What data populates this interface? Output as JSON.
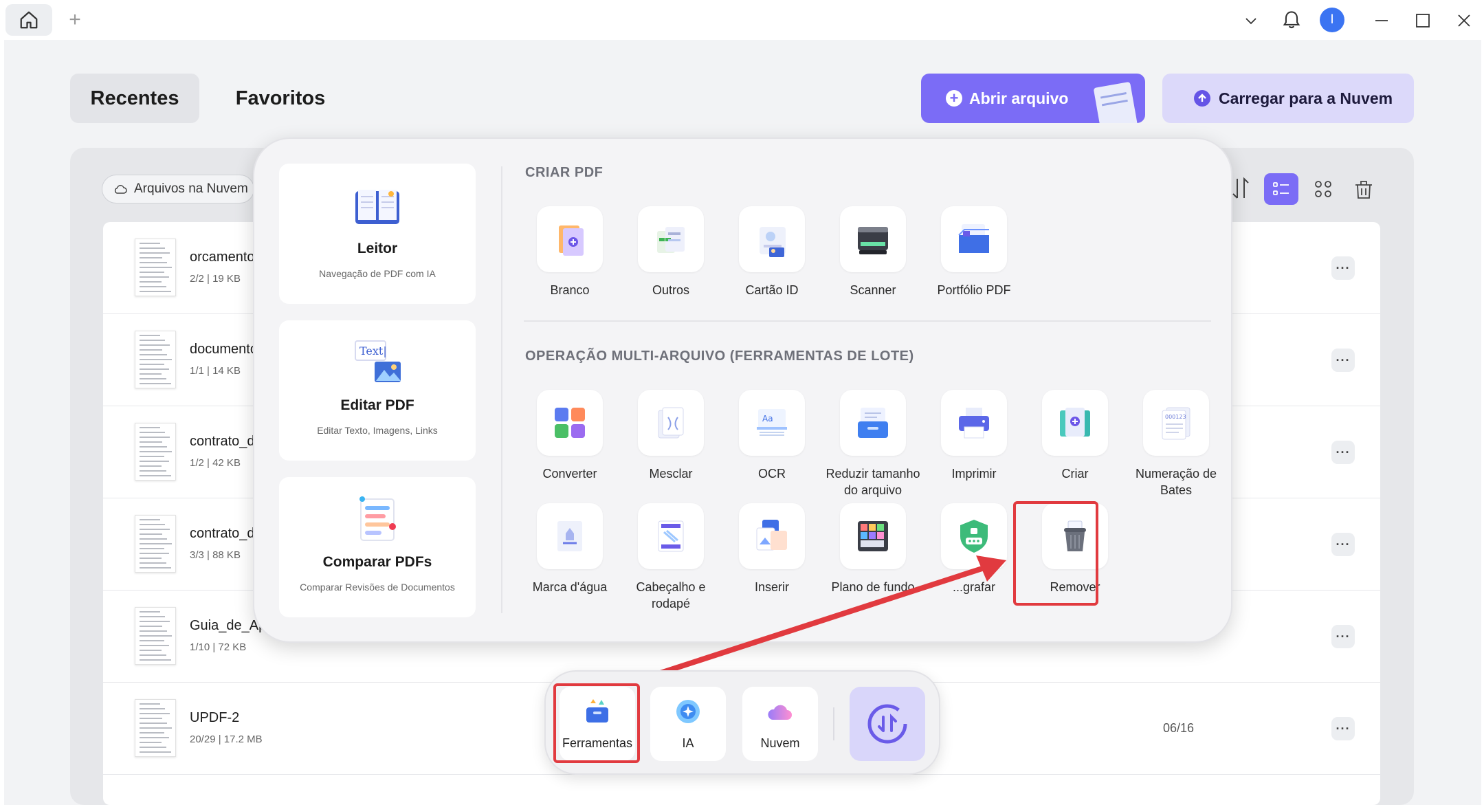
{
  "titlebar": {
    "home_tab": "home-icon",
    "new_tab": "+",
    "avatar_letter": "I"
  },
  "tabs": {
    "recent": "Recentes",
    "favorites": "Favoritos"
  },
  "buttons": {
    "open_file": "Abrir arquivo",
    "upload_cloud": "Carregar para a Nuvem",
    "cloud_files": "Arquivos na Nuvem"
  },
  "files": [
    {
      "name": "orcamento_",
      "meta": "2/2 | 19 KB",
      "date": ""
    },
    {
      "name": "documento",
      "meta": "1/1 | 14 KB",
      "date": ""
    },
    {
      "name": "contrato_de",
      "meta": "1/2 | 42 KB",
      "date": ""
    },
    {
      "name": "contrato_de",
      "meta": "3/3 | 88 KB",
      "date": ""
    },
    {
      "name": "Guia_de_Ap",
      "meta": "1/10 | 72 KB",
      "date": ""
    },
    {
      "name": "UPDF-2",
      "meta": "20/29 | 17.2 MB",
      "date": "06/16"
    }
  ],
  "popup": {
    "cards": [
      {
        "title": "Leitor",
        "subtitle": "Navegação de PDF com IA"
      },
      {
        "title": "Editar PDF",
        "subtitle": "Editar Texto, Imagens, Links"
      },
      {
        "title": "Comparar PDFs",
        "subtitle": "Comparar Revisões de Documentos"
      }
    ],
    "create_title": "CRIAR PDF",
    "create_items": [
      {
        "label": "Branco",
        "icon": "blank-page-icon"
      },
      {
        "label": "Outros",
        "icon": "other-files-icon"
      },
      {
        "label": "Cartão ID",
        "icon": "id-card-icon"
      },
      {
        "label": "Scanner",
        "icon": "scanner-icon"
      },
      {
        "label": "Portfólio PDF",
        "icon": "portfolio-icon"
      }
    ],
    "batch_title": "OPERAÇÃO MULTI-ARQUIVO (FERRAMENTAS DE LOTE)",
    "batch_items": [
      {
        "label": "Converter",
        "icon": "convert-icon"
      },
      {
        "label": "Mesclar",
        "icon": "merge-icon"
      },
      {
        "label": "OCR",
        "icon": "ocr-icon"
      },
      {
        "label": "Reduzir tamanho do arquivo",
        "icon": "compress-icon"
      },
      {
        "label": "Imprimir",
        "icon": "printer-icon"
      },
      {
        "label": "Criar",
        "icon": "create-icon"
      },
      {
        "label": "Numeração de Bates",
        "icon": "bates-icon"
      },
      {
        "label": "Marca d'água",
        "icon": "watermark-icon"
      },
      {
        "label": "Cabeçalho e rodapé",
        "icon": "header-footer-icon"
      },
      {
        "label": "Inserir",
        "icon": "insert-icon"
      },
      {
        "label": "Plano de fundo",
        "icon": "background-icon"
      },
      {
        "label": "...grafar",
        "icon": "encrypt-shield-icon"
      },
      {
        "label": "Remover",
        "icon": "trash-icon"
      }
    ]
  },
  "dock": {
    "tools": "Ferramentas",
    "ai": "IA",
    "cloud": "Nuvem"
  },
  "colors": {
    "accent": "#7b6cf6",
    "highlight": "#e13a3f",
    "accent_light": "#dcd9fa"
  }
}
